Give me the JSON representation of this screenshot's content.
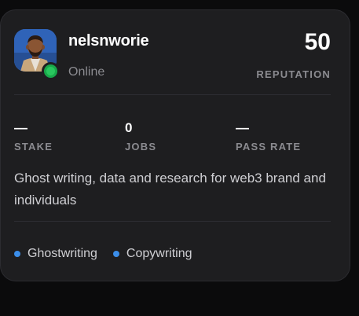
{
  "profile": {
    "username": "nelsnworie",
    "status": "Online",
    "reputation_value": "50",
    "reputation_label": "REPUTATION",
    "avatar_icon": "person-portrait-icon",
    "status_color": "#29c75e"
  },
  "stats": [
    {
      "value": "—",
      "label": "STAKE"
    },
    {
      "value": "0",
      "label": "JOBS"
    },
    {
      "value": "—",
      "label": "PASS RATE"
    }
  ],
  "bio": "Ghost writing, data and research for web3 brand and individuals",
  "tags": [
    {
      "label": "Ghostwriting",
      "color": "#3b8eea"
    },
    {
      "label": "Copywriting",
      "color": "#3b8eea"
    }
  ],
  "colors": {
    "card_background": "#1e1e20",
    "page_background": "#0b0b0c",
    "muted_text": "#8b8b90"
  }
}
